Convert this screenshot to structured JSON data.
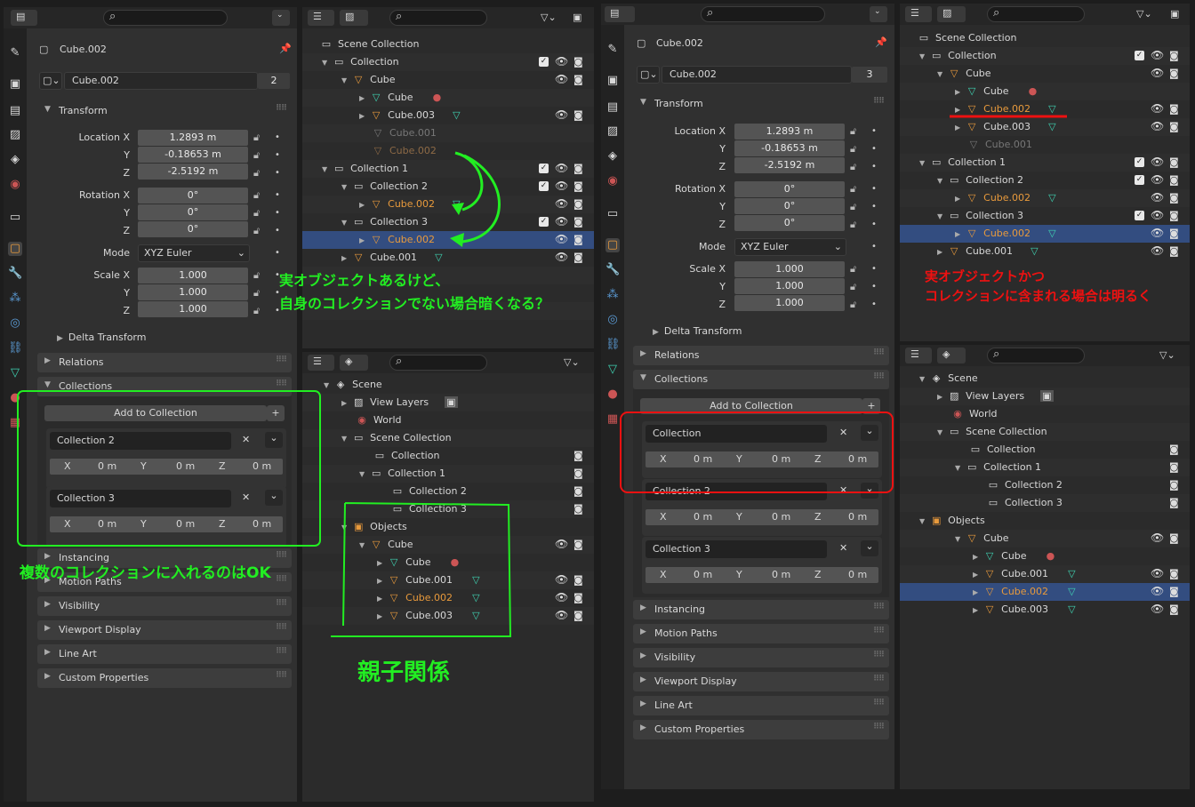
{
  "left": {
    "props": {
      "object_name": "Cube.002",
      "data_name": "Cube.002",
      "users": "2",
      "transform_title": "Transform",
      "location_x_label": "Location X",
      "y_label": "Y",
      "z_label": "Z",
      "loc_x": "1.2893 m",
      "loc_y": "-0.18653 m",
      "loc_z": "-2.5192 m",
      "rotation_x_label": "Rotation X",
      "rot_x": "0°",
      "rot_y": "0°",
      "rot_z": "0°",
      "mode_label": "Mode",
      "mode": "XYZ Euler",
      "scale_x_label": "Scale X",
      "scale_x": "1.000",
      "scale_y": "1.000",
      "scale_z": "1.000",
      "delta": "Delta Transform",
      "relations": "Relations",
      "collections": "Collections",
      "add_to_collection": "Add to Collection",
      "coll_items": [
        "Collection 2",
        "Collection 3"
      ],
      "x": "X",
      "y": "Y",
      "z": "Z",
      "zero": "0 m",
      "instancing": "Instancing",
      "motion": "Motion Paths",
      "visibility": "Visibility",
      "viewport": "Viewport Display",
      "lineart": "Line Art",
      "custom": "Custom Properties"
    },
    "outliner_top": {
      "scene_collection": "Scene Collection",
      "collection": "Collection",
      "cube": "Cube",
      "cube_mesh": "Cube",
      "cube003": "Cube.003",
      "cube001": "Cube.001",
      "cube002": "Cube.002",
      "collection1": "Collection 1",
      "collection2": "Collection 2",
      "collection3": "Collection 3"
    },
    "outliner_bottom": {
      "scene": "Scene",
      "view_layers": "View Layers",
      "world": "World",
      "scene_collection": "Scene Collection",
      "collection": "Collection",
      "collection1": "Collection 1",
      "collection2": "Collection 2",
      "collection3": "Collection 3",
      "objects": "Objects",
      "cube": "Cube",
      "cube_mesh": "Cube",
      "cube001": "Cube.001",
      "cube002": "Cube.002",
      "cube003": "Cube.003"
    },
    "annotations": {
      "a1": "実オブジェクトあるけど、",
      "a2": "自身のコレクションでない場合暗くなる？",
      "a3": "複数のコレクションに入れるのはOK",
      "a4": "親子関係"
    }
  },
  "right": {
    "props": {
      "object_name": "Cube.002",
      "data_name": "Cube.002",
      "users": "3",
      "transform_title": "Transform",
      "location_x_label": "Location X",
      "y_label": "Y",
      "z_label": "Z",
      "loc_x": "1.2893 m",
      "loc_y": "-0.18653 m",
      "loc_z": "-2.5192 m",
      "rotation_x_label": "Rotation X",
      "rot_x": "0°",
      "rot_y": "0°",
      "rot_z": "0°",
      "mode_label": "Mode",
      "mode": "XYZ Euler",
      "scale_x_label": "Scale X",
      "scale_x": "1.000",
      "scale_y": "1.000",
      "scale_z": "1.000",
      "delta": "Delta Transform",
      "relations": "Relations",
      "collections": "Collections",
      "add_to_collection": "Add to Collection",
      "coll_items": [
        "Collection",
        "Collection 2",
        "Collection 3"
      ],
      "x": "X",
      "y": "Y",
      "z": "Z",
      "zero": "0 m",
      "instancing": "Instancing",
      "motion": "Motion Paths",
      "visibility": "Visibility",
      "viewport": "Viewport Display",
      "lineart": "Line Art",
      "custom": "Custom Properties"
    },
    "outliner_top": {
      "scene_collection": "Scene Collection",
      "collection": "Collection",
      "cube": "Cube",
      "cube_mesh": "Cube",
      "cube002": "Cube.002",
      "cube003": "Cube.003",
      "cube001": "Cube.001",
      "collection1": "Collection 1",
      "collection2": "Collection 2",
      "collection3": "Collection 3"
    },
    "outliner_bottom": {
      "scene": "Scene",
      "view_layers": "View Layers",
      "world": "World",
      "scene_collection": "Scene Collection",
      "collection": "Collection",
      "collection1": "Collection 1",
      "collection2": "Collection 2",
      "collection3": "Collection 3",
      "objects": "Objects",
      "cube": "Cube",
      "cube_mesh": "Cube",
      "cube001": "Cube.001",
      "cube002": "Cube.002",
      "cube003": "Cube.003"
    },
    "annotations": {
      "a1": "実オブジェクトかつ",
      "a2": "コレクションに含まれる場合は明るく"
    }
  },
  "colors": {
    "accent_orange": "#e89a3c",
    "vertex_teal": "#3fd3b2",
    "selection": "#334d80",
    "annot_green": "#22ee22",
    "annot_red": "#ee1111"
  }
}
